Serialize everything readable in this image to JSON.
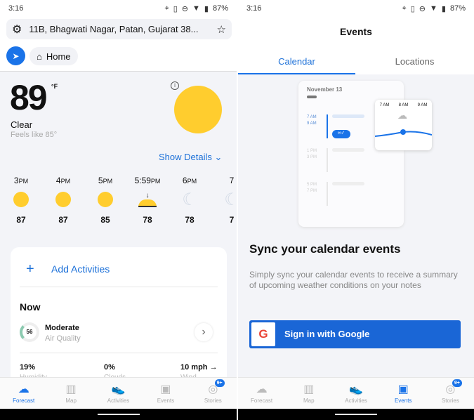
{
  "status": {
    "time": "3:16",
    "battery": "87%"
  },
  "forecast": {
    "address": "11B, Bhagwati Nagar, Patan, Gujarat 38...",
    "home_label": "Home",
    "temp": "89",
    "unit": "°F",
    "condition": "Clear",
    "feels_like": "Feels like 85°",
    "show_details": "Show Details",
    "hourly": [
      {
        "time": "3",
        "ampm": "PM",
        "icon": "sun",
        "temp": "87"
      },
      {
        "time": "4",
        "ampm": "PM",
        "icon": "sun",
        "temp": "87"
      },
      {
        "time": "5",
        "ampm": "PM",
        "icon": "sun",
        "temp": "85"
      },
      {
        "time": "5:59",
        "ampm": "PM",
        "icon": "sunset",
        "temp": "78"
      },
      {
        "time": "6",
        "ampm": "PM",
        "icon": "moon",
        "temp": "78"
      },
      {
        "time": "7",
        "ampm": "",
        "icon": "moon",
        "temp": "7"
      }
    ],
    "add_activities": "Add Activities",
    "now_title": "Now",
    "aqi": {
      "value": "56",
      "level": "Moderate",
      "label": "Air Quality"
    },
    "metrics": [
      {
        "value": "19%",
        "label": "Humidity"
      },
      {
        "value": "0%",
        "label": "Clouds"
      },
      {
        "value": "10 mph",
        "label": "Wind"
      }
    ]
  },
  "events": {
    "title": "Events",
    "tabs": [
      "Calendar",
      "Locations"
    ],
    "illustration": {
      "date": "November 13",
      "slots": [
        [
          "7 AM",
          "9 AM"
        ],
        [
          "1 PM",
          "3 PM"
        ],
        [
          "5 PM",
          "7 PM"
        ]
      ],
      "popup_hours": [
        "7 AM",
        "8 AM",
        "9 AM"
      ]
    },
    "heading": "Sync your calendar events",
    "body": "Simply sync your calendar events to receive a summary of upcoming weather conditions on your notes",
    "signin": "Sign in with Google"
  },
  "nav": {
    "items": [
      "Forecast",
      "Map",
      "Activities",
      "Events",
      "Stories"
    ],
    "badge": "9+"
  },
  "colors": {
    "accent": "#1a73e8",
    "sun": "#ffcd2e"
  }
}
